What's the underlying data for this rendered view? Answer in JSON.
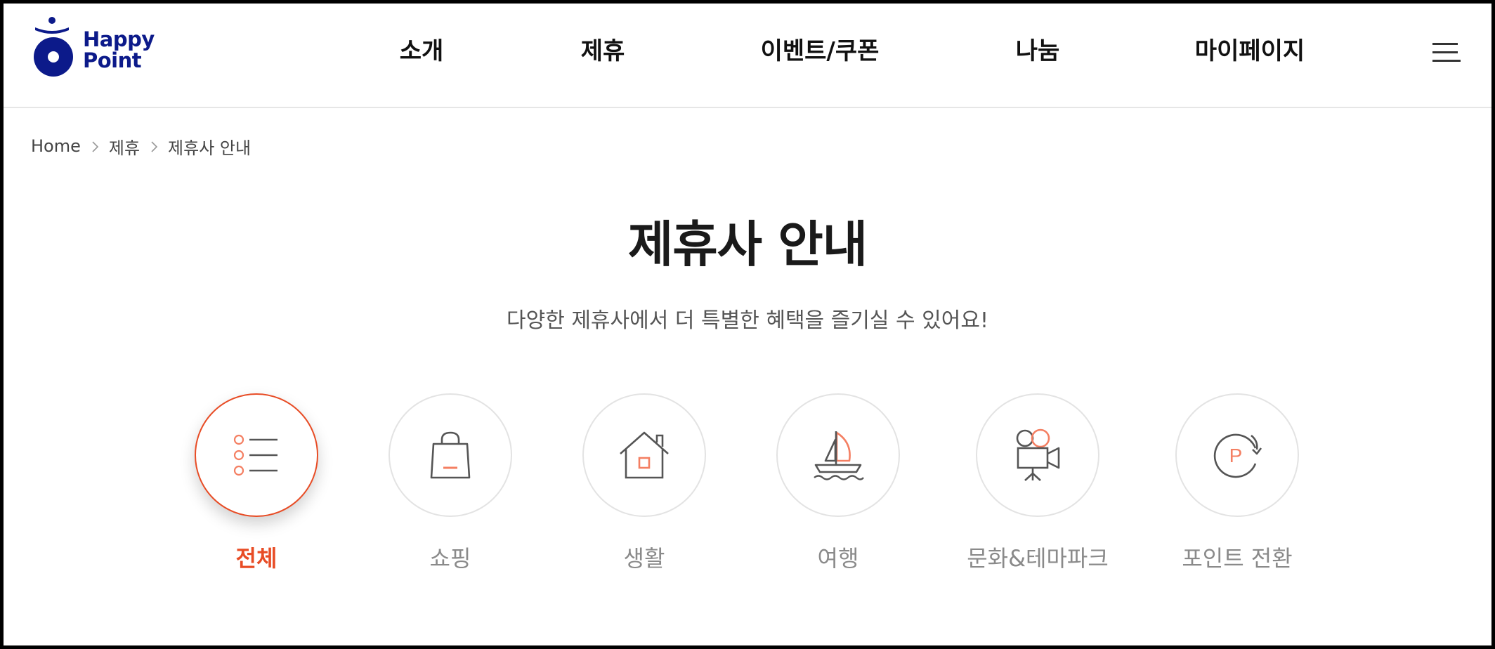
{
  "brand": {
    "logo_line1": "Happy",
    "logo_line2": "Point",
    "color": "#0c1a8a"
  },
  "nav": {
    "items": [
      {
        "label": "소개"
      },
      {
        "label": "제휴"
      },
      {
        "label": "이벤트/쿠폰"
      },
      {
        "label": "나눔"
      },
      {
        "label": "마이페이지"
      }
    ],
    "menu_icon": "hamburger-menu-icon"
  },
  "breadcrumb": {
    "items": [
      "Home",
      "제휴",
      "제휴사 안내"
    ],
    "separator_icon": "chevron-right-icon"
  },
  "page": {
    "title": "제휴사 안내",
    "subtitle": "다양한 제휴사에서 더 특별한 혜택을 즐기실 수 있어요!"
  },
  "categories": [
    {
      "label": "전체",
      "icon": "list-icon",
      "active": true
    },
    {
      "label": "쇼핑",
      "icon": "shopping-bag-icon",
      "active": false
    },
    {
      "label": "생활",
      "icon": "house-icon",
      "active": false
    },
    {
      "label": "여행",
      "icon": "sailboat-icon",
      "active": false
    },
    {
      "label": "문화&테마파크",
      "icon": "movie-camera-icon",
      "active": false
    },
    {
      "label": "포인트 전환",
      "icon": "point-exchange-icon",
      "active": false
    }
  ],
  "colors": {
    "accent": "#e84c25",
    "icon_accent": "#f47f62",
    "icon_stroke": "#555555",
    "text_muted": "#8a8a8a"
  }
}
